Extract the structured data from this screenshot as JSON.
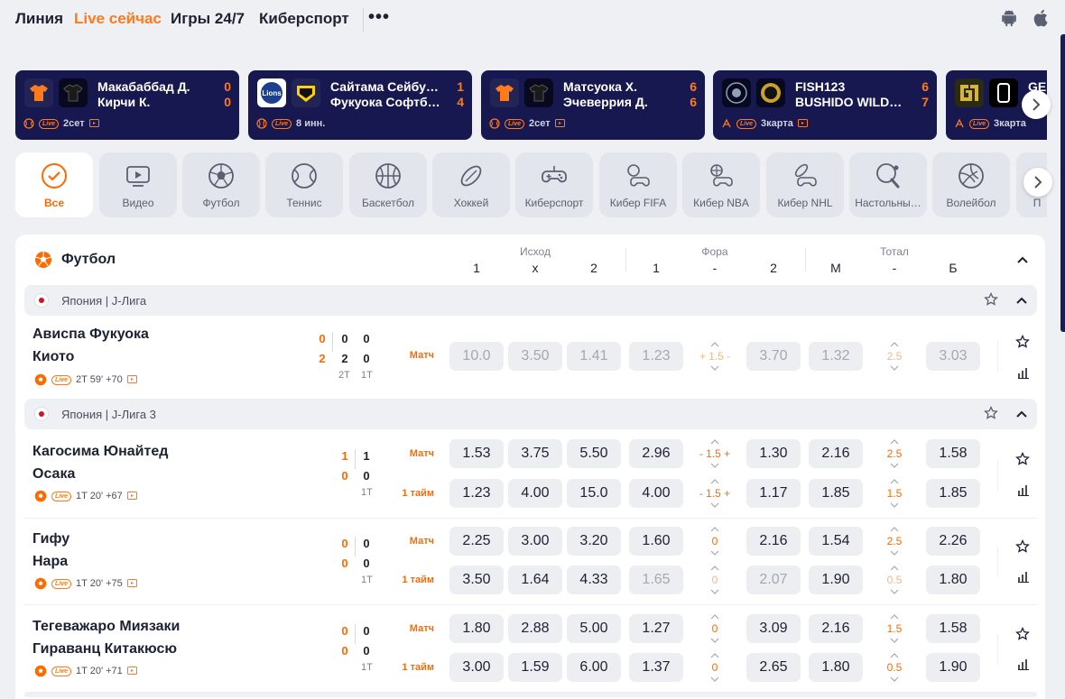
{
  "nav": {
    "items": [
      {
        "label": "Линия",
        "active": false
      },
      {
        "label": "Live сейчас",
        "active": true
      },
      {
        "label": "Игры 24/7",
        "active": false
      },
      {
        "label": "Киберспорт",
        "active": false
      }
    ],
    "more_label": "•••",
    "icons": [
      "android-icon",
      "apple-icon"
    ]
  },
  "live_cards": [
    {
      "team1": "Макабаббад Д.",
      "team2": "Кирчи К.",
      "score1": "0",
      "score2": "0",
      "period": "2сет",
      "sport": "tennis"
    },
    {
      "team1": "Сайтама Сейбу…",
      "team2": "Фукуока Софтб…",
      "score1": "1",
      "score2": "4",
      "period": "8 инн.",
      "sport": "baseball"
    },
    {
      "team1": "Матсуока Х.",
      "team2": "Эчеверрия Д.",
      "score1": "6",
      "score2": "6",
      "period": "2сет",
      "sport": "tennis"
    },
    {
      "team1": "FISH123",
      "team2": "BUSHIDO WILD…",
      "score1": "6",
      "score2": "7",
      "period": "3карта",
      "sport": "esports"
    },
    {
      "team1": "GE",
      "team2": "",
      "score1": "",
      "score2": "",
      "period": "3карта",
      "sport": "esports"
    }
  ],
  "sports": [
    {
      "label": "Все",
      "icon": "check-circle-icon",
      "active": true
    },
    {
      "label": "Видео",
      "icon": "video-icon"
    },
    {
      "label": "Футбол",
      "icon": "football-icon"
    },
    {
      "label": "Теннис",
      "icon": "tennis-icon"
    },
    {
      "label": "Баскетбол",
      "icon": "basketball-icon"
    },
    {
      "label": "Хоккей",
      "icon": "hockey-icon"
    },
    {
      "label": "Киберспорт",
      "icon": "gamepad-icon"
    },
    {
      "label": "Кибер FIFA",
      "icon": "cyber-fifa-icon"
    },
    {
      "label": "Кибер NBA",
      "icon": "cyber-nba-icon"
    },
    {
      "label": "Кибер NHL",
      "icon": "cyber-nhl-icon"
    },
    {
      "label": "Настольны…",
      "icon": "table-tennis-icon"
    },
    {
      "label": "Волейбол",
      "icon": "volleyball-icon"
    },
    {
      "label": "П",
      "icon": "more-sport-icon"
    }
  ],
  "section": {
    "title": "Футбол",
    "groups": [
      {
        "label": "Исход",
        "cols": [
          "1",
          "x",
          "2"
        ]
      },
      {
        "label": "Фора",
        "cols": [
          "1",
          "-",
          "2"
        ]
      },
      {
        "label": "Тотал",
        "cols": [
          "М",
          "-",
          "Б"
        ]
      }
    ]
  },
  "leagues": [
    {
      "name": "Япония | J-Лига",
      "matches": [
        {
          "team1": "Ависпа Фукуока",
          "team2": "Киото",
          "meta": "2T 59' +70",
          "scores": [
            [
              "0",
              "0",
              "0"
            ],
            [
              "2",
              "2",
              "0"
            ]
          ],
          "periods": [
            "2T",
            "1T"
          ],
          "lines": [
            {
              "type": "Матч",
              "dim": true,
              "odds": [
                "10.0",
                "3.50",
                "1.41",
                "1.23",
                "+ 1.5 -",
                "3.70",
                "1.32",
                "2.5",
                "3.03"
              ]
            }
          ]
        }
      ]
    },
    {
      "name": "Япония | J-Лига 3",
      "matches": [
        {
          "team1": "Кагосима Юнайтед",
          "team2": "Осака",
          "meta": "1T 20' +67",
          "scores": [
            [
              "1",
              "1"
            ],
            [
              "0",
              "0"
            ]
          ],
          "periods": [
            "1T"
          ],
          "lines": [
            {
              "type": "Матч",
              "odds": [
                "1.53",
                "3.75",
                "5.50",
                "2.96",
                "- 1.5 +",
                "1.30",
                "2.16",
                "2.5",
                "1.58"
              ]
            },
            {
              "type": "1 тайм",
              "odds": [
                "1.23",
                "4.00",
                "15.0",
                "4.00",
                "- 1.5 +",
                "1.17",
                "1.85",
                "1.5",
                "1.85"
              ]
            }
          ]
        },
        {
          "team1": "Гифу",
          "team2": "Нара",
          "meta": "1T 20' +75",
          "scores": [
            [
              "0",
              "0"
            ],
            [
              "0",
              "0"
            ]
          ],
          "periods": [
            "1T"
          ],
          "lines": [
            {
              "type": "Матч",
              "odds": [
                "2.25",
                "3.00",
                "3.20",
                "1.60",
                "0",
                "2.16",
                "1.54",
                "2.5",
                "2.26"
              ]
            },
            {
              "type": "1 тайм",
              "dim_hcap": true,
              "odds": [
                "3.50",
                "1.64",
                "4.33",
                "1.65",
                "0",
                "2.07",
                "1.90",
                "0.5",
                "1.80"
              ]
            }
          ]
        },
        {
          "team1": "Тегеважаро Миязаки",
          "team2": "Гираванц Китакюсю",
          "meta": "1T 20' +71",
          "scores": [
            [
              "0",
              "0"
            ],
            [
              "0",
              "0"
            ]
          ],
          "periods": [
            "1T"
          ],
          "lines": [
            {
              "type": "Матч",
              "odds": [
                "1.80",
                "2.88",
                "5.00",
                "1.27",
                "0",
                "3.09",
                "2.16",
                "1.5",
                "1.58"
              ]
            },
            {
              "type": "1 тайм",
              "odds": [
                "3.00",
                "1.59",
                "6.00",
                "1.37",
                "0",
                "2.65",
                "1.80",
                "0.5",
                "1.90"
              ]
            }
          ]
        }
      ]
    }
  ],
  "colors": {
    "accent": "#ff6a00",
    "card_bg": "#17184f",
    "odd_bg": "#eceef2"
  }
}
